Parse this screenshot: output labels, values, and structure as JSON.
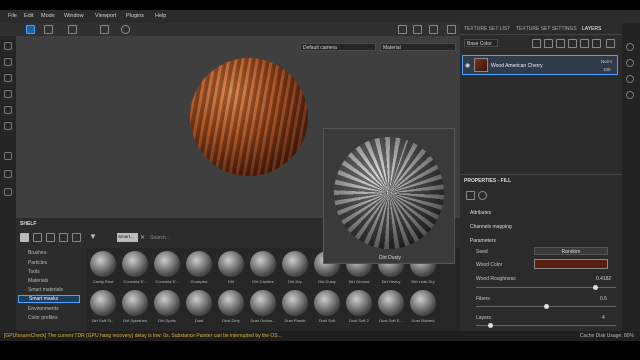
{
  "menu": [
    "File",
    "Edit",
    "Mode",
    "Window",
    "Viewport",
    "Plugins",
    "Help"
  ],
  "viewport": {
    "camera": "Default camera",
    "channel": "Material"
  },
  "preview": {
    "label": "Dirt Dusty"
  },
  "shelf": {
    "title": "SHELF",
    "search_value": "Smart...",
    "search_placeholder": "Search...",
    "categories": [
      "Brushes",
      "Particles",
      "Tools",
      "Materials",
      "Smart materials",
      "Smart masks",
      "Environments",
      "Color profiles"
    ],
    "row1": [
      "Cavity Rust",
      "Concrete E...",
      "Concrete E...",
      "Crumples",
      "Dirt",
      "Dirt Cavities",
      "Dirt Dry",
      "Dirt Dusty",
      "Dirt Ground",
      "Dirt Heavy",
      "Dirt Leak Dry"
    ],
    "row2": [
      "Dirt Soft St...",
      "Dirt Splashes",
      "Dirt Spots",
      "Dust",
      "Dust Dirty",
      "Dust Occlus...",
      "Dust Plastic",
      "Dust Soft",
      "Dust Soft 2",
      "Dust Soft E...",
      "Dust Stained"
    ]
  },
  "texture_panel": {
    "tabs": [
      "TEXTURE SET LIST",
      "TEXTURE SET SETTINGS",
      "LAYERS"
    ],
    "channel": "Base Color",
    "layer": {
      "name": "Wood American Cherry",
      "blend": "Norm",
      "opacity": "100"
    }
  },
  "properties": {
    "title": "PROPERTIES - FILL",
    "sections": [
      "Attributes",
      "Channels mapping",
      "Parameters"
    ],
    "seed_label": "Seed",
    "seed_value": "Random",
    "wood_color_label": "Wood Color",
    "wood_roughness_label": "Wood Roughness",
    "wood_roughness_value": "0.4182",
    "fibers_label": "Fibers",
    "fibers_value": "0.5",
    "layers_label": "Layers",
    "layers_value": "4"
  },
  "status": {
    "message": "[GPUIssuesCheck] The current TDR (GPU hang recovery) delay is low: 0s. Substance Painter can be interrupted by the OS...",
    "cache": "Cache Disk Usage: 80%"
  },
  "colors": {
    "accent": "#4aa3ff",
    "wood_color": "#5a1f0c",
    "warning": "#e3b23c"
  },
  "chart_data": null
}
